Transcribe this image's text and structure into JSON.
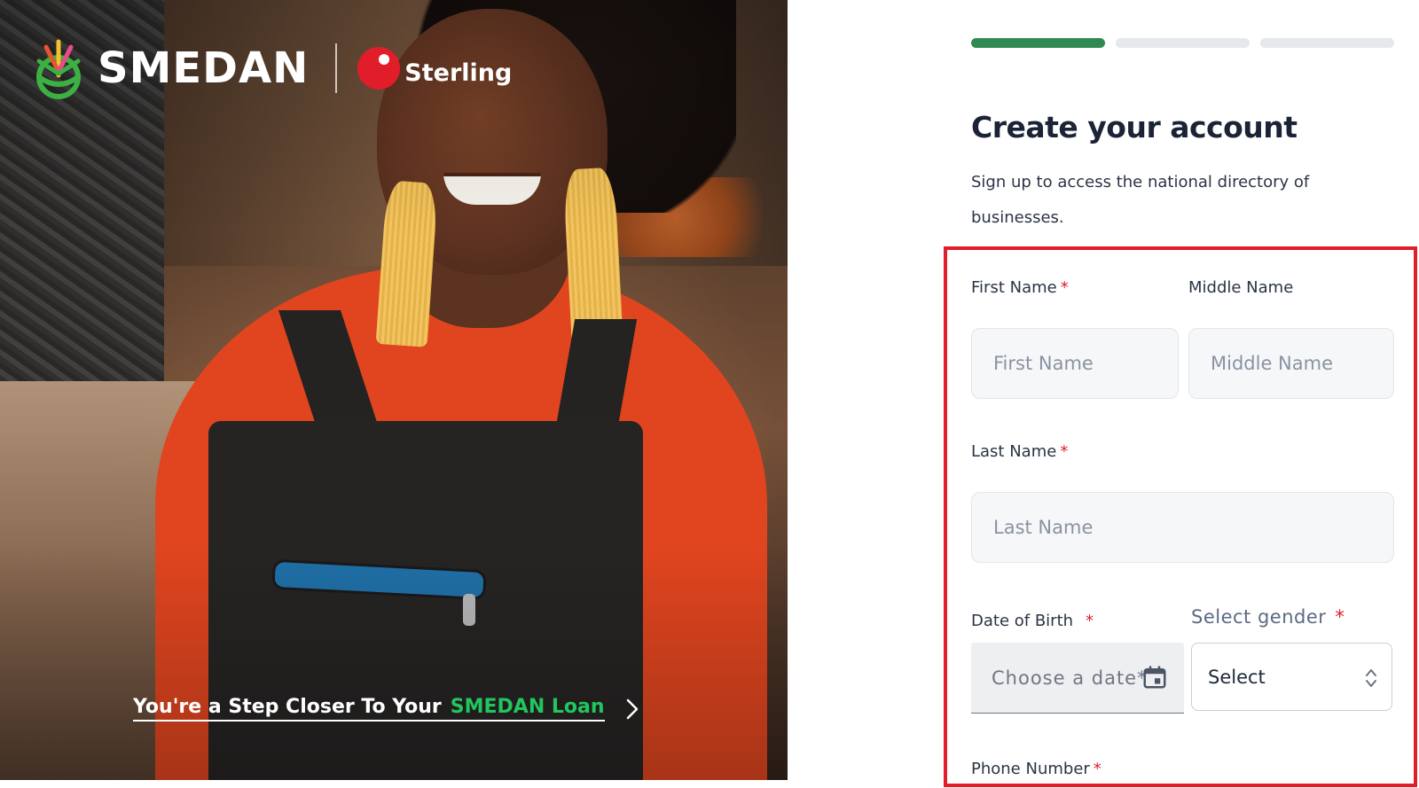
{
  "hero": {
    "brand": "SMEDAN",
    "partner": "Sterling",
    "tagline_prefix": "You're a Step Closer To Your",
    "tagline_highlight": "SMEDAN Loan"
  },
  "progress": {
    "total_steps": 3,
    "current_step": 1
  },
  "form": {
    "title": "Create your account",
    "subtitle": "Sign up to access the national directory of businesses.",
    "first_name": {
      "label": "First Name",
      "required": "*",
      "placeholder": "First Name"
    },
    "middle_name": {
      "label": "Middle Name",
      "placeholder": "Middle Name"
    },
    "last_name": {
      "label": "Last Name",
      "required": "*",
      "placeholder": "Last Name"
    },
    "dob": {
      "label": "Date of Birth",
      "required": "*",
      "placeholder": "Choose a date*"
    },
    "gender": {
      "label": "Select gender",
      "required": "*",
      "value": "Select"
    },
    "phone": {
      "label": "Phone Number",
      "required": "*"
    }
  },
  "colors": {
    "accent_green": "#2f8a51",
    "loan_green": "#22c55e",
    "required_red": "#e11d2a",
    "highlight_red": "#e11d2a",
    "sterling_red": "#e11d2a"
  },
  "icons": {
    "calendar": "calendar-icon",
    "select_arrows": "updown-chevron-icon",
    "tagline_arrow": "chevron-right-icon"
  }
}
